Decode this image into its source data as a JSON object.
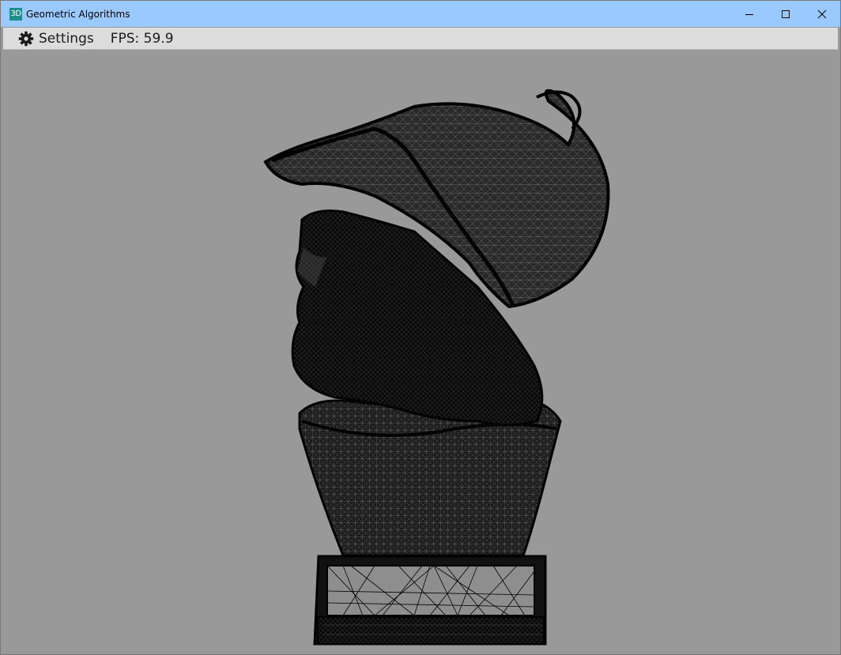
{
  "window": {
    "title": "Geometric Algorithms",
    "app_icon_text": "3D",
    "titlebar_color": "#99c9ff",
    "controls": [
      "minimize-icon",
      "maximize-icon",
      "close-icon"
    ]
  },
  "menubar": {
    "settings_label": "Settings",
    "settings_icon": "gear-icon",
    "fps_text": "FPS: 59.9"
  },
  "viewport": {
    "background": "#999999",
    "model": "wireframe-bust-with-helmet",
    "wire_color": "#000000"
  }
}
